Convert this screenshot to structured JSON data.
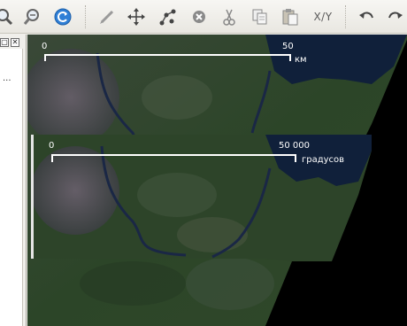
{
  "toolbar": {
    "icons": [
      "zoom-in-icon",
      "zoom-out-icon",
      "refresh-icon",
      "pencil-icon",
      "move-icon",
      "node-edit-icon",
      "delete-icon",
      "cut-icon",
      "copy-icon",
      "paste-icon",
      "xy-coordinates",
      "undo-icon",
      "redo-icon"
    ],
    "xy_label": "X/Y"
  },
  "left_panel": {
    "float_button": "▢",
    "close_button": "✕",
    "truncated_text": "..."
  },
  "map": {
    "scalebar_top": {
      "start_label": "0",
      "end_label": "50",
      "unit_label": "км"
    },
    "scalebar_overlay": {
      "start_label": "0",
      "end_label": "50 000",
      "unit_label": "градусов"
    }
  },
  "colors": {
    "toolbar_bg": "#ece9e3",
    "map_dark": "#0f1a2b",
    "vegetation": "#2f4a2b",
    "water": "#0d1f3a",
    "scalebar": "#ffffff"
  }
}
